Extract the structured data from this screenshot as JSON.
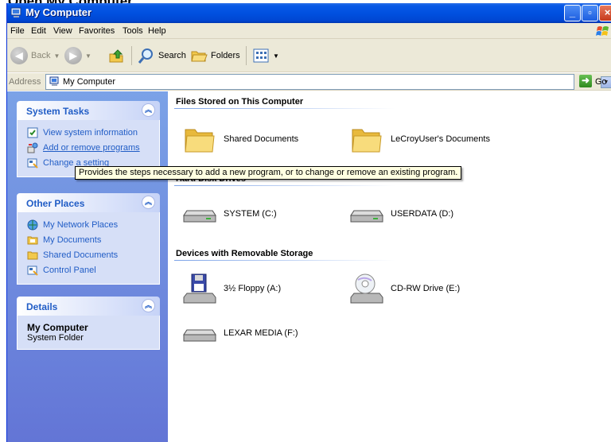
{
  "caption": "Open My Computer",
  "window": {
    "title": "My Computer"
  },
  "menu": [
    "File",
    "Edit",
    "View",
    "Favorites",
    "Tools",
    "Help"
  ],
  "toolbar": {
    "back_label": "Back",
    "search_label": "Search",
    "folders_label": "Folders"
  },
  "address": {
    "label": "Address",
    "value": "My Computer",
    "go_label": "Go"
  },
  "panels": {
    "system_tasks": {
      "title": "System Tasks",
      "items": [
        "View system information",
        "Add or remove programs",
        "Change a setting"
      ]
    },
    "other_places": {
      "title": "Other Places",
      "items": [
        "My Network Places",
        "My Documents",
        "Shared Documents",
        "Control Panel"
      ]
    },
    "details": {
      "title": "Details",
      "name": "My Computer",
      "subtitle": "System Folder"
    }
  },
  "groups": {
    "files": {
      "title": "Files Stored on This Computer",
      "items": [
        "Shared Documents",
        "LeCroyUser's Documents"
      ]
    },
    "hdd": {
      "title": "Hard Disk Drives",
      "items": [
        "SYSTEM (C:)",
        "USERDATA (D:)"
      ]
    },
    "removable": {
      "title": "Devices with Removable Storage",
      "items": [
        "3½ Floppy (A:)",
        "CD-RW Drive (E:)",
        "LEXAR MEDIA (F:)"
      ]
    }
  },
  "tooltip": "Provides the steps necessary to add a new program, or to change or remove an existing program.",
  "colors": {
    "title_bar": "#0050e0",
    "task_pane": "#7ba2e7",
    "link": "#215dc6"
  }
}
